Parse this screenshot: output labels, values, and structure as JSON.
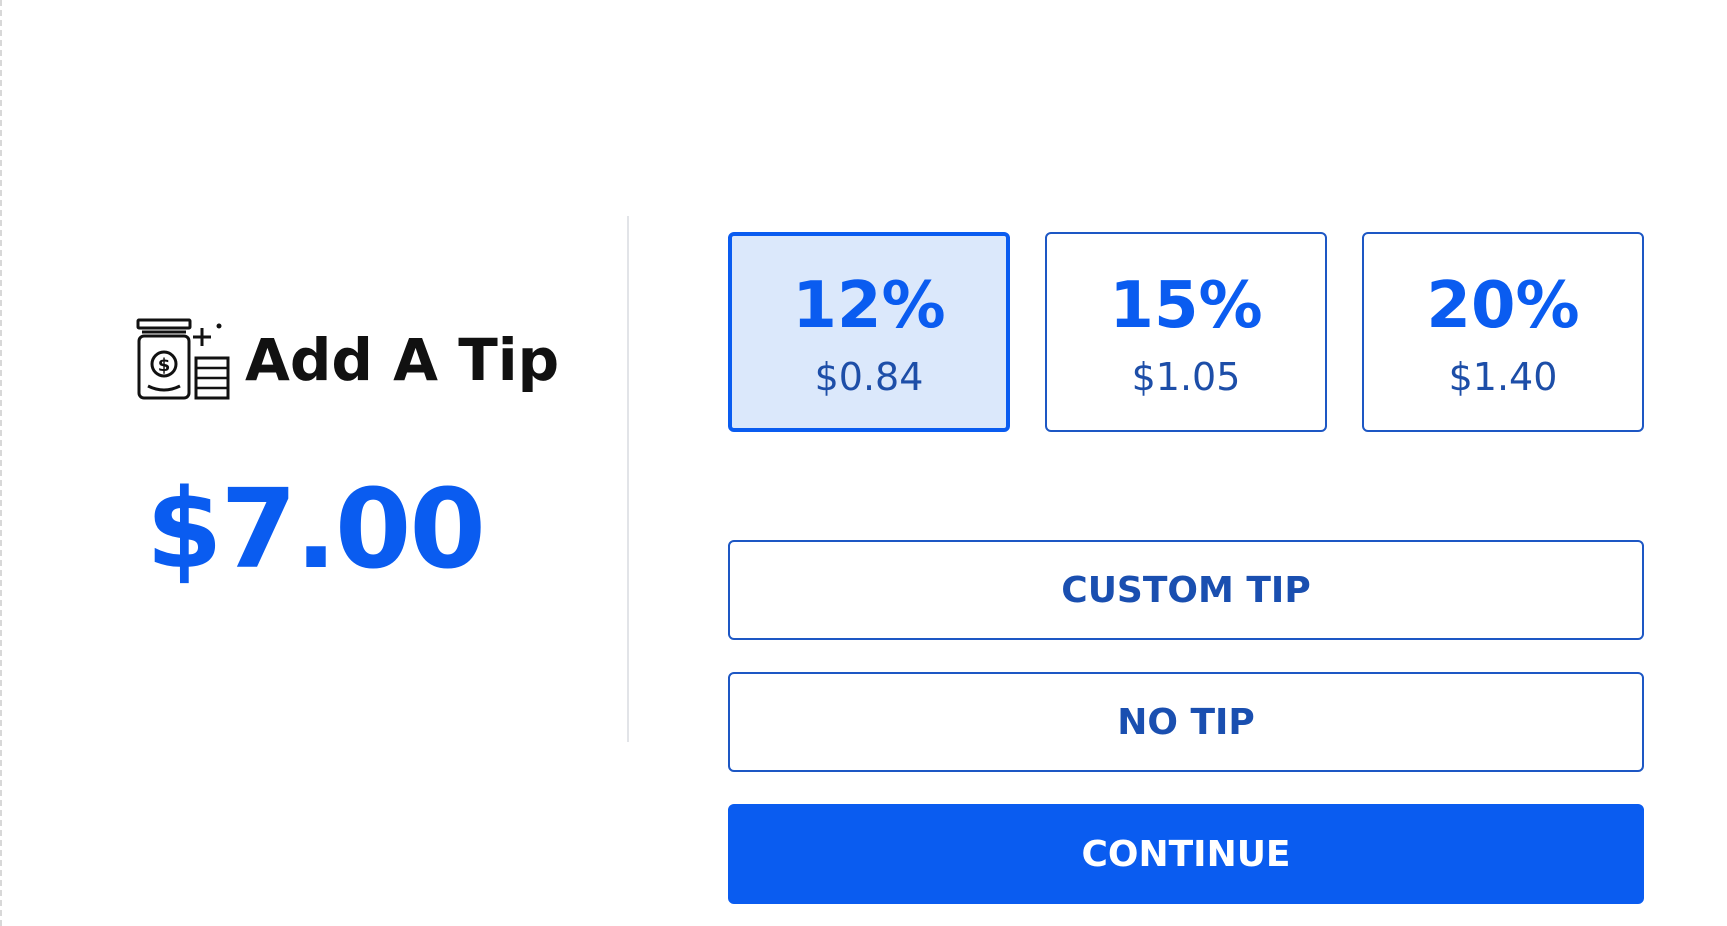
{
  "header": {
    "icon": "tip-jar-coins-icon",
    "title": "Add A Tip"
  },
  "total": {
    "amount": "$7.00"
  },
  "tip_options": [
    {
      "percent": "12%",
      "amount": "$0.84",
      "selected": true
    },
    {
      "percent": "15%",
      "amount": "$1.05",
      "selected": false
    },
    {
      "percent": "20%",
      "amount": "$1.40",
      "selected": false
    }
  ],
  "actions": {
    "custom_tip": "CUSTOM TIP",
    "no_tip": "NO TIP",
    "continue": "CONTINUE"
  },
  "colors": {
    "accent": "#0a5cf0",
    "selected_bg": "#dbe8fb",
    "border": "#1d57c4"
  }
}
